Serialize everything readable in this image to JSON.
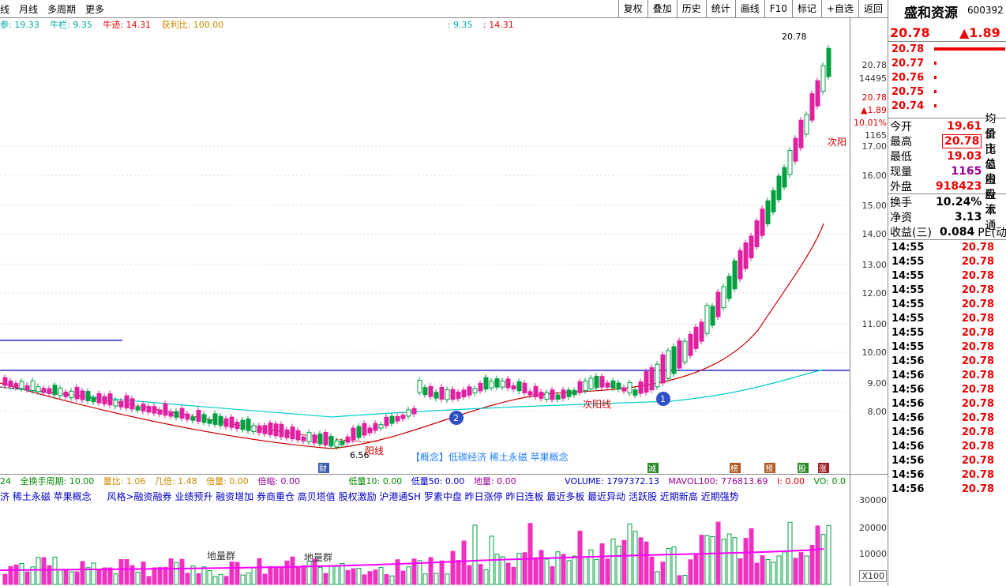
{
  "toolbar": {
    "left": [
      "线",
      "月线",
      "多周期",
      "更多"
    ],
    "right": [
      "复权",
      "叠加",
      "历史",
      "统计",
      "画线",
      "F10",
      "标记",
      "+自选",
      "返回"
    ]
  },
  "legend": {
    "item1": "参: 19.33",
    "niu_lan": "牛栏: 9.35",
    "niu_ji": "牛迹: 14.31",
    "huoli": "获利比: 100.00",
    "mid1": ": 9.35",
    "mid2": ": 14.31"
  },
  "yaxis": [
    "17.00",
    "16.00",
    "15.00",
    "14.00",
    "13.00",
    "12.00",
    "11.00",
    "10.00",
    "9.00",
    "8.00"
  ],
  "yaxis_info": [
    "20.78",
    "14495",
    "20.78",
    "▲1.89",
    "10.01%",
    "1165"
  ],
  "chart_labels": {
    "high_label": "20.78",
    "low_label": "6.56",
    "concept": "【概念】低碳经济 稀土永磁 苹果概念",
    "yang1": "阳线",
    "yang2": "次阳线",
    "yang3": "次阳",
    "cai": "财",
    "badges": [
      "减",
      "榜",
      "预",
      "股",
      "涨"
    ],
    "circle1": "1",
    "circle2": "2"
  },
  "volrow": {
    "a": "24",
    "b": "全换手周期: 10.00",
    "c": "量比: 1.06",
    "d": "几倍: 1.48",
    "e": "倍量: 0.00",
    "f": "倍缩: 0.00",
    "g": "低量10: 0.00",
    "h": "低量50: 0.00",
    "i": "地量: 0.00",
    "j": "VOLUME: 1797372.13",
    "k": "MAVOL100: 776813.69",
    "l": "I: 0.00",
    "m": "VO: 0.0"
  },
  "conrow": {
    "a": "济 稀土永磁 苹果概念",
    "b": "风格>融资融券 业绩预升 融资增加 券商重仓 高贝塔值 股权激励 沪港通SH 罗素中盘 昨日涨停 昨日连板 最近多板 最近异动 活跃股 近期新高 近期强势"
  },
  "vol_axis": [
    "30000",
    "20000",
    "10000",
    "X100"
  ],
  "vol_labels": [
    "地量群",
    "地量群"
  ],
  "sidebar": {
    "name": "盛和资源",
    "code": "600392",
    "price": "20.78",
    "change": "▲1.89",
    "orderbook": [
      "20.78",
      "20.77",
      "20.76",
      "20.75",
      "20.74"
    ],
    "quote": [
      {
        "l": "今开",
        "v": "19.61",
        "r": "均价"
      },
      {
        "l": "最高",
        "v": "20.78",
        "r": "量比"
      },
      {
        "l": "最低",
        "v": "19.03",
        "r": "市值"
      },
      {
        "l": "现量",
        "v": "1165",
        "r": "总量"
      },
      {
        "l": "外盘",
        "v": "918423",
        "r": "内盘"
      }
    ],
    "quote2": [
      {
        "l": "换手",
        "v": "10.24%",
        "r": "股本"
      },
      {
        "l": "净资",
        "v": "3.13",
        "r": "流通"
      },
      {
        "l": "收益(三)",
        "v": "0.084",
        "r": "PE(动"
      }
    ],
    "ticks": [
      {
        "t": "14:55",
        "p": "20.78"
      },
      {
        "t": "14:55",
        "p": "20.78"
      },
      {
        "t": "14:55",
        "p": "20.78"
      },
      {
        "t": "14:55",
        "p": "20.78"
      },
      {
        "t": "14:55",
        "p": "20.78"
      },
      {
        "t": "14:55",
        "p": "20.78"
      },
      {
        "t": "14:55",
        "p": "20.78"
      },
      {
        "t": "14:55",
        "p": "20.78"
      },
      {
        "t": "14:56",
        "p": "20.78"
      },
      {
        "t": "14:56",
        "p": "20.78"
      },
      {
        "t": "14:56",
        "p": "20.78"
      },
      {
        "t": "14:56",
        "p": "20.78"
      },
      {
        "t": "14:56",
        "p": "20.78"
      },
      {
        "t": "14:56",
        "p": "20.78"
      },
      {
        "t": "14:56",
        "p": "20.78"
      },
      {
        "t": "14:56",
        "p": "20.78"
      },
      {
        "t": "14:56",
        "p": "20.78"
      },
      {
        "t": "14:56",
        "p": "20.78"
      }
    ]
  }
}
